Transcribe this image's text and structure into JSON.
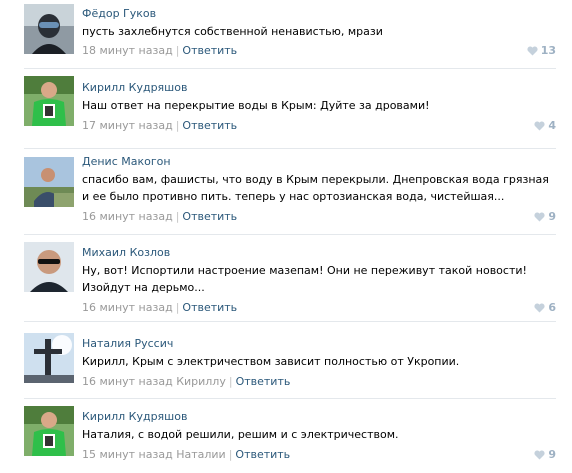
{
  "comments": [
    {
      "author": "Фёдор Гуков",
      "text": "пусть захлебнутся собственной ненавистью, мрази",
      "time": "18 минут назад",
      "reply_label": "Ответить",
      "addressee": "",
      "likes": "13",
      "avatar": "dark-figure-avatar"
    },
    {
      "author": "Кирилл Кудряшов",
      "text": "Наш ответ на перекрытие воды в Крым: Дуйте за дровами!",
      "time": "17 минут назад",
      "reply_label": "Ответить",
      "addressee": "",
      "likes": "4",
      "avatar": "green-shirt-avatar"
    },
    {
      "author": "Денис Макогон",
      "text": "спасибо вам, фашисты, что воду в Крым перекрыли. Днепровская вода грязная и ее было противно пить. теперь у нас ортозианская вода, чистейшая...",
      "time": "16 минут назад",
      "reply_label": "Ответить",
      "addressee": "",
      "likes": "9",
      "avatar": "landscape-man-avatar"
    },
    {
      "author": "Михаил Козлов",
      "text": "Ну, вот! Испортили настроение мазепам! Они не переживут такой новости! Изойдут на дерьмо...",
      "time": "16 минут назад",
      "reply_label": "Ответить",
      "addressee": "",
      "likes": "6",
      "avatar": "sunglasses-man-avatar"
    },
    {
      "author": "Наталия Руссич",
      "text": "Кирилл, Крым с электричеством зависит полностью от Укропии.",
      "time": "16 минут назад",
      "reply_label": "Ответить",
      "addressee": "Кириллу",
      "likes": "",
      "avatar": "cross-sky-avatar"
    },
    {
      "author": "Кирилл Кудряшов",
      "text": "Наталия, с водой решили, решим и с электричеством.",
      "time": "15 минут назад",
      "reply_label": "Ответить",
      "addressee": "Наталии",
      "likes": "9",
      "avatar": "green-shirt-avatar"
    }
  ],
  "colors": {
    "link": "#2b587a",
    "meta": "#999999",
    "likes": "#9eb1c3",
    "divider": "#e4e8ec"
  }
}
